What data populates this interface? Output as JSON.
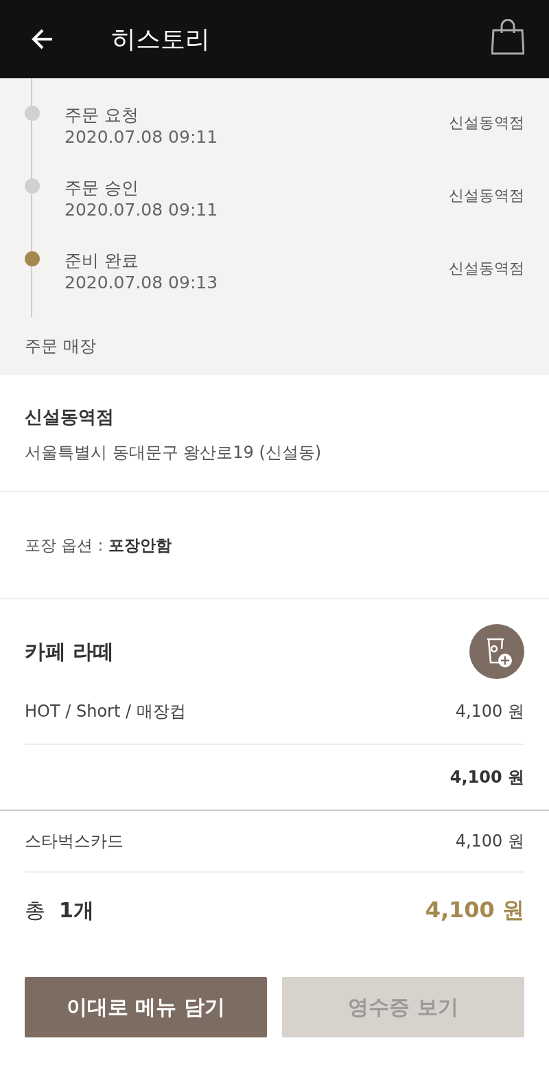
{
  "header": {
    "title": "히스토리"
  },
  "timeline": [
    {
      "label": "주문 요청",
      "time": "2020.07.08 09:11",
      "store": "신설동역점",
      "active": false
    },
    {
      "label": "주문 승인",
      "time": "2020.07.08 09:11",
      "store": "신설동역점",
      "active": false
    },
    {
      "label": "준비 완료",
      "time": "2020.07.08 09:13",
      "store": "신설동역점",
      "active": true
    }
  ],
  "store_section_label": "주문 매장",
  "store": {
    "name": "신설동역점",
    "address": "서울특별시 동대문구 왕산로19 (신설동)"
  },
  "packaging": "포장 옵션 : **포장안함**",
  "item": {
    "name": "카페 라떼",
    "option": "HOT / Short / 매장컵",
    "option_price": "4,100 원",
    "subtotal": "4,100 원"
  },
  "payment": {
    "method": "스타벅스카드",
    "amount": "4,100 원"
  },
  "total": {
    "label": "총",
    "count": "1개",
    "amount": "4,100 원"
  },
  "buttons": [
    {
      "label": "이대로 메뉴 담기",
      "disabled": false
    },
    {
      "label": "영수증 보기",
      "disabled": true
    }
  ]
}
